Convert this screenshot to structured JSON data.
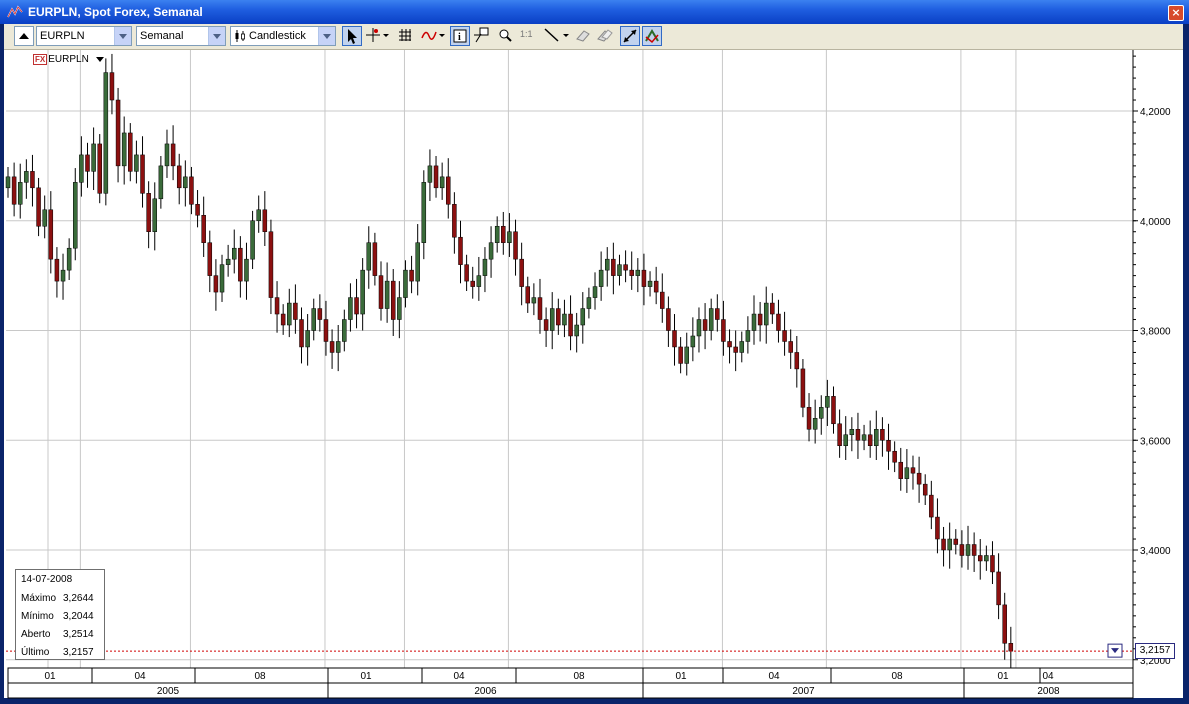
{
  "window": {
    "title": "EURPLN, Spot Forex, Semanal",
    "close_glyph": "×"
  },
  "toolbar": {
    "symbol_value": "EURPLN",
    "period_value": "Semanal",
    "chart_type_value": "Candlestick",
    "ratio_label": "1:1",
    "icons": [
      "collapse-icon",
      "cursor-icon",
      "crosshair-icon",
      "grid-icon",
      "indicator-icon",
      "info-icon",
      "pin-icon",
      "zoom-icon",
      "ratio-icon",
      "line-tool-icon",
      "eraser-icon",
      "clear-icon",
      "autoscale-icon",
      "auto-update-icon"
    ]
  },
  "symbol_tag": {
    "badge": "FX",
    "label": "EURPLN"
  },
  "info_box": {
    "date": "14-07-2008",
    "rows": [
      {
        "label": "Máximo",
        "value": "3,2644"
      },
      {
        "label": "Mínimo",
        "value": "3,2044"
      },
      {
        "label": "Aberto",
        "value": "3,2514"
      },
      {
        "label": "Último",
        "value": "3,2157"
      }
    ]
  },
  "last_price_tag": "3,2157",
  "colors": {
    "up": "#3a6b3a",
    "down": "#8c1010",
    "grid": "#c8c8c8",
    "last_line": "#d00000"
  },
  "chart_data": {
    "type": "candlestick",
    "symbol": "EURPLN",
    "y_ticks": [
      "4,2000",
      "4,0000",
      "3,8000",
      "3,6000",
      "3,4000",
      "3,2000"
    ],
    "y_tick_values": [
      4.2,
      4.0,
      3.8,
      3.6,
      3.4,
      3.2
    ],
    "ylim": [
      3.18,
      4.32
    ],
    "month_ticks": [
      "01",
      "04",
      "08",
      "01",
      "04",
      "08",
      "01",
      "04",
      "08",
      "01",
      "04"
    ],
    "month_tick_weeks": [
      0,
      12,
      30,
      52,
      65,
      82,
      104,
      117,
      134,
      156,
      165
    ],
    "years": [
      "2005",
      "2006",
      "2007",
      "2008"
    ],
    "year_boundary_weeks": [
      0,
      52,
      104,
      156,
      184
    ],
    "last": 3.2157,
    "closes": [
      4.08,
      4.03,
      4.07,
      4.09,
      4.06,
      3.99,
      4.02,
      3.93,
      3.89,
      3.91,
      3.95,
      4.07,
      4.12,
      4.09,
      4.14,
      4.05,
      4.27,
      4.22,
      4.1,
      4.16,
      4.09,
      4.12,
      4.05,
      3.98,
      4.04,
      4.1,
      4.14,
      4.1,
      4.06,
      4.08,
      4.03,
      4.01,
      3.96,
      3.9,
      3.87,
      3.92,
      3.93,
      3.95,
      3.89,
      3.93,
      4.0,
      4.02,
      3.98,
      3.86,
      3.83,
      3.81,
      3.85,
      3.82,
      3.77,
      3.8,
      3.84,
      3.82,
      3.78,
      3.76,
      3.78,
      3.82,
      3.86,
      3.83,
      3.91,
      3.96,
      3.9,
      3.84,
      3.89,
      3.82,
      3.86,
      3.91,
      3.89,
      3.96,
      4.07,
      4.1,
      4.06,
      4.08,
      4.03,
      3.97,
      3.92,
      3.89,
      3.88,
      3.9,
      3.93,
      3.96,
      3.99,
      3.96,
      3.98,
      3.93,
      3.88,
      3.85,
      3.86,
      3.82,
      3.8,
      3.84,
      3.81,
      3.83,
      3.79,
      3.81,
      3.84,
      3.86,
      3.88,
      3.91,
      3.93,
      3.9,
      3.92,
      3.91,
      3.9,
      3.91,
      3.88,
      3.89,
      3.87,
      3.84,
      3.8,
      3.77,
      3.74,
      3.77,
      3.79,
      3.82,
      3.8,
      3.84,
      3.82,
      3.78,
      3.77,
      3.76,
      3.78,
      3.8,
      3.83,
      3.81,
      3.85,
      3.83,
      3.8,
      3.78,
      3.76,
      3.73,
      3.66,
      3.62,
      3.64,
      3.66,
      3.68,
      3.63,
      3.59,
      3.61,
      3.62,
      3.6,
      3.61,
      3.59,
      3.62,
      3.6,
      3.58,
      3.56,
      3.53,
      3.55,
      3.54,
      3.52,
      3.5,
      3.46,
      3.42,
      3.4,
      3.42,
      3.41,
      3.39,
      3.41,
      3.39,
      3.38,
      3.39,
      3.36,
      3.3,
      3.23,
      3.2157
    ],
    "series": [
      {
        "name": "EURPLN",
        "values": "see closes"
      }
    ]
  }
}
